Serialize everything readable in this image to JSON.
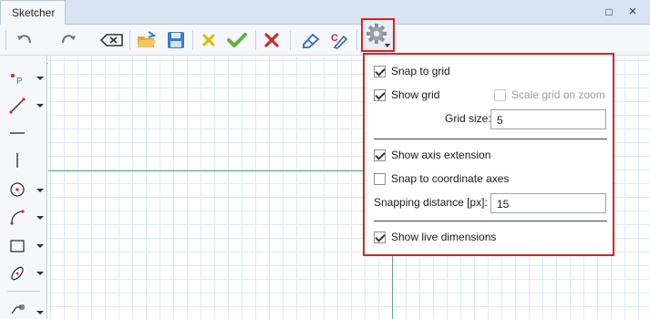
{
  "window": {
    "tab_label": "Sketcher",
    "restore_glyph": "□",
    "close_glyph": "×"
  },
  "toolbar": {
    "icons": [
      "undo-icon",
      "redo-icon",
      "delete-backspace-icon",
      "open-folder-icon",
      "save-icon",
      "clear-x-icon",
      "accept-check-icon",
      "cancel-x-icon",
      "eraser-icon",
      "dimension-edit-icon",
      "gear-icon"
    ],
    "accent_red": "#e41d1d"
  },
  "left_tools": [
    "point-icon",
    "line-icon",
    "horizontal-line-icon",
    "vertical-line-icon",
    "circle-icon",
    "arc-icon",
    "rectangle-icon",
    "ellipse-icon",
    "polyline-icon"
  ],
  "settings": {
    "snap_to_grid": {
      "label": "Snap to grid",
      "checked": true
    },
    "show_grid": {
      "label": "Show grid",
      "checked": true
    },
    "scale_grid": {
      "label": "Scale grid on zoom",
      "checked": false,
      "disabled": true
    },
    "grid_size": {
      "label": "Grid size:",
      "value": "5"
    },
    "show_axis_extension": {
      "label": "Show axis extension",
      "checked": true
    },
    "snap_to_axes": {
      "label": "Snap to coordinate axes",
      "checked": false
    },
    "snapping_distance": {
      "label": "Snapping distance [px]:",
      "value": "15"
    },
    "show_live_dimensions": {
      "label": "Show live dimensions",
      "checked": true
    }
  }
}
